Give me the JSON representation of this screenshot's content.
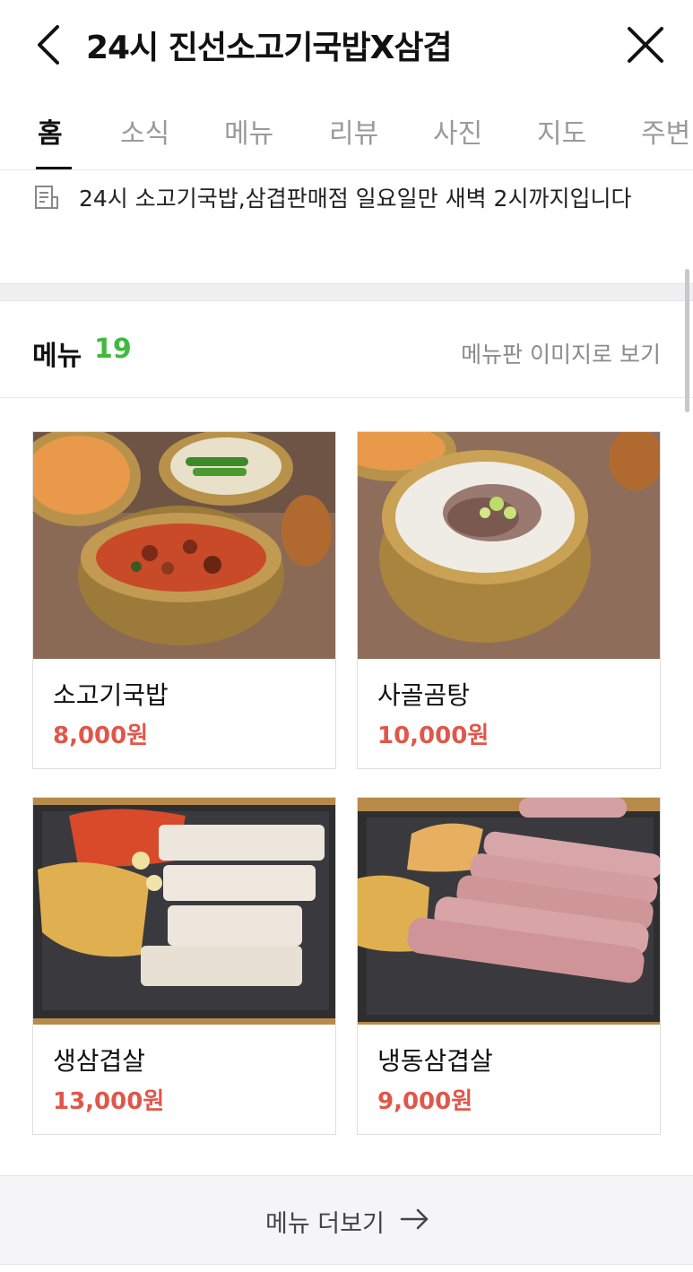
{
  "header": {
    "back_icon": "chevron-left-icon",
    "title": "24시 진선소고기국밥X삼겹",
    "close_icon": "close-icon"
  },
  "tabs": [
    {
      "label": "홈",
      "active": true
    },
    {
      "label": "소식",
      "active": false
    },
    {
      "label": "메뉴",
      "active": false
    },
    {
      "label": "리뷰",
      "active": false
    },
    {
      "label": "사진",
      "active": false
    },
    {
      "label": "지도",
      "active": false
    },
    {
      "label": "주변",
      "active": false
    }
  ],
  "notice": {
    "icon": "document-icon",
    "text": "24시 소고기국밥,삼겹판매점 일요일만 새벽 2시까지입니다"
  },
  "menu": {
    "title": "메뉴",
    "count": "19",
    "board_link": "메뉴판 이미지로 보기",
    "items": [
      {
        "name": "소고기국밥",
        "price": "8,000원"
      },
      {
        "name": "사골곰탕",
        "price": "10,000원"
      },
      {
        "name": "생삼겹살",
        "price": "13,000원"
      },
      {
        "name": "냉동삼겹살",
        "price": "9,000원"
      }
    ],
    "more_label": "메뉴 더보기",
    "more_icon": "arrow-right-icon"
  },
  "colors": {
    "accent_green": "#3fba3f",
    "price_red": "#e0574a",
    "text_dark": "#111111",
    "text_muted": "#9a9a9a"
  }
}
